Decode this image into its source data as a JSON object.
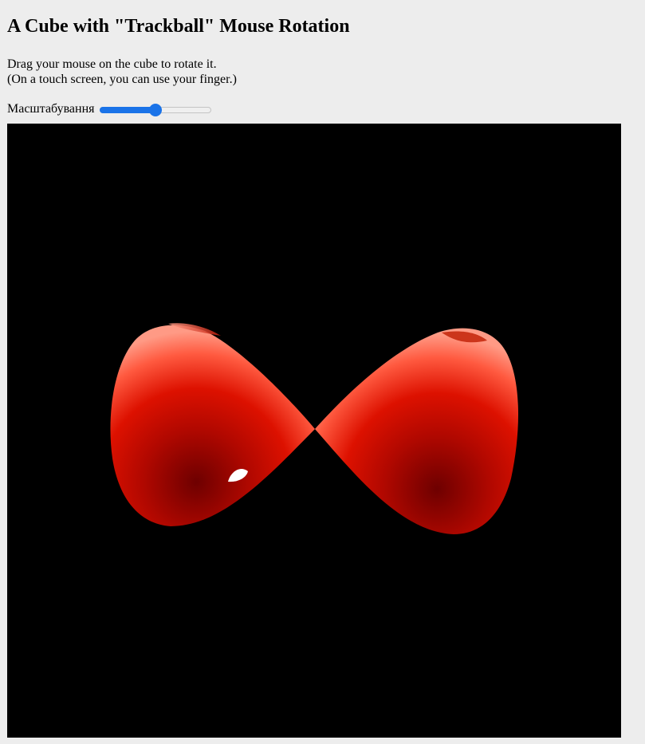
{
  "page": {
    "title": "A Cube with \"Trackball\" Mouse Rotation",
    "instruction_line1": "Drag your mouse on the cube to rotate it.",
    "instruction_line2": "(On a touch screen, you can use your finger.)"
  },
  "zoom": {
    "label": "Масштабування",
    "value_fraction": 0.5
  },
  "viewport": {
    "background": "#000000",
    "object_color": "#dd1100",
    "highlight_color": "#ffffff"
  }
}
